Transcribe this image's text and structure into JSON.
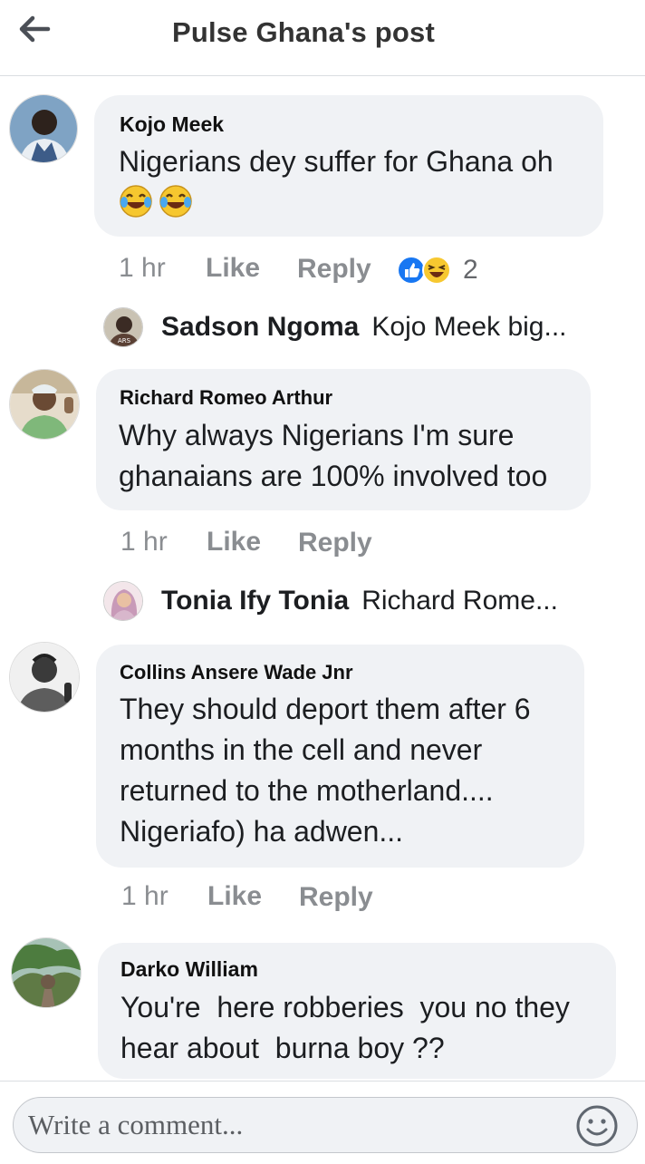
{
  "header": {
    "title": "Pulse Ghana's post",
    "back_icon": "arrow-left-icon"
  },
  "comments": [
    {
      "author": "Kojo Meek",
      "lines": [
        "Nigerians dey suffer for Ghana oh"
      ],
      "emoji": [
        "😂",
        "😂"
      ],
      "time": "1 hr",
      "like": "Like",
      "reply": "Reply",
      "reactions": {
        "icons": [
          "like-reaction-icon",
          "haha-reaction-icon"
        ],
        "count": "2"
      },
      "reply_preview": {
        "name": "Sadson Ngoma",
        "text": "Kojo Meek big..."
      }
    },
    {
      "author": "Richard Romeo Arthur",
      "lines": [
        "Why always Nigerians I'm sure",
        "ghanaians are 100% involved too"
      ],
      "time": "1 hr",
      "like": "Like",
      "reply": "Reply",
      "reply_preview": {
        "name": "Tonia Ify Tonia",
        "text": "Richard Rome..."
      }
    },
    {
      "author": "Collins Ansere Wade Jnr",
      "lines": [
        "They should deport them after 6",
        "months in the cell and never",
        "returned to the motherland....",
        "Nigeriafo) ha adwen..."
      ],
      "time": "1 hr",
      "like": "Like",
      "reply": "Reply"
    },
    {
      "author": "Darko William",
      "lines": [
        "You're  here robberies  you no they",
        "hear about  burna boy ??"
      ]
    }
  ],
  "composer": {
    "placeholder": "Write a comment...",
    "emoji_icon": "smiley-icon"
  },
  "colors": {
    "bubble": "#f0f2f5",
    "meta": "#8a8d91",
    "like_blue": "#1877f2",
    "haha_yellow": "#f7c830"
  }
}
